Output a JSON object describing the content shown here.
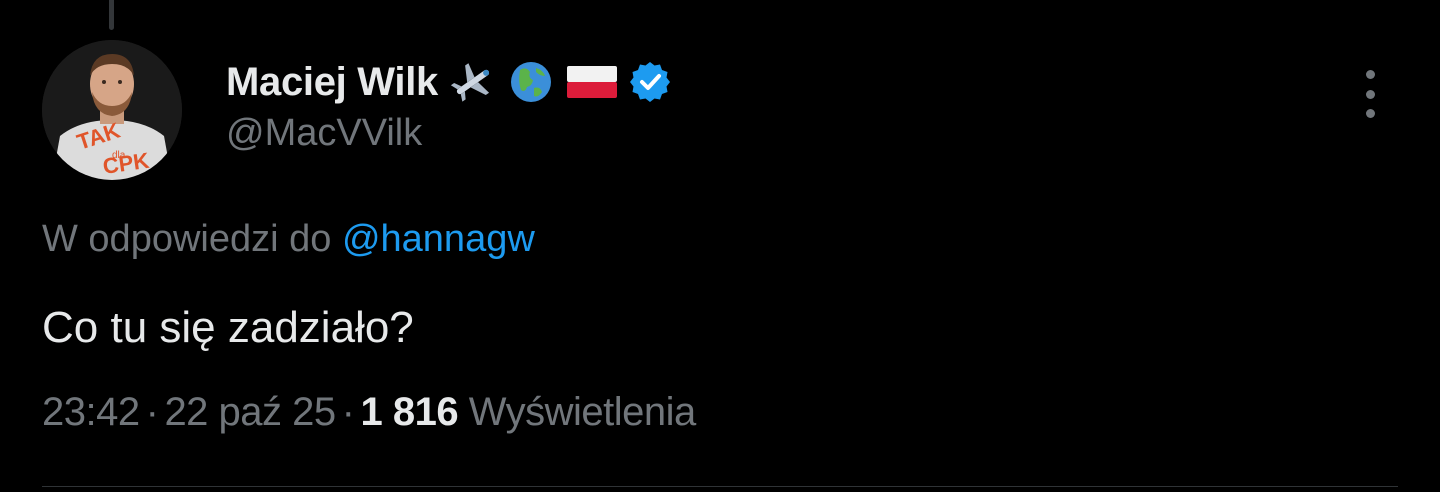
{
  "author": {
    "name": "Maciej Wilk",
    "handle": "@MacVVilk",
    "name_emojis": [
      "airplane-icon",
      "globe-americas-icon",
      "poland-flag-icon"
    ],
    "verified": true,
    "avatar_shirt_text_top": "TAK",
    "avatar_shirt_text_mid": "dla",
    "avatar_shirt_text_bottom": "CPK"
  },
  "reply": {
    "prefix": "W odpowiedzi do",
    "mention": "@hannagw"
  },
  "tweet": {
    "text": "Co tu się zadziało?"
  },
  "meta": {
    "time": "23:42",
    "date": "22 paź 25",
    "separator": "·",
    "views_count": "1 816",
    "views_label": "Wyświetlenia"
  },
  "colors": {
    "background": "#000000",
    "text_primary": "#e7e9ea",
    "text_secondary": "#71767b",
    "accent": "#1d9bf0",
    "divider": "#2f3336"
  }
}
